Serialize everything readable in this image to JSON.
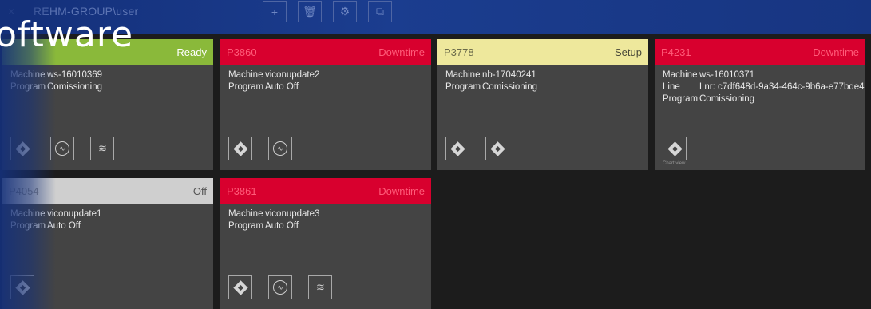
{
  "topbar": {
    "close_glyph": "×",
    "user": "REHM-GROUP\\user",
    "buttons": [
      {
        "icon": "plus-icon",
        "glyph": "+"
      },
      {
        "icon": "trash-icon",
        "glyph": "🗑"
      },
      {
        "icon": "gear-icon",
        "glyph": "⚙"
      },
      {
        "icon": "network-icon",
        "glyph": "⧉"
      }
    ]
  },
  "overlay_title": "oftware",
  "labels": {
    "machine": "Machine",
    "program": "Program",
    "line": "Line"
  },
  "tiles": [
    {
      "id": "",
      "status": "Ready",
      "head_bg": "#8ab93a",
      "id_color": "#e6f2cc",
      "status_color": "#ffffff",
      "machine": "ws-16010369",
      "program": "Comissioning"
    },
    {
      "id": "P3860",
      "status": "Downtime",
      "head_bg": "#d8002e",
      "id_color": "#ff5b79",
      "status_color": "#ff5b79",
      "machine": "viconupdate2",
      "program": "Auto Off"
    },
    {
      "id": "P3778",
      "status": "Setup",
      "head_bg": "#eee89c",
      "id_color": "#6a6a4a",
      "status_color": "#4a4a3a",
      "machine": "nb-17040241",
      "program": "Comissioning"
    },
    {
      "id": "P4231",
      "status": "Downtime",
      "head_bg": "#d8002e",
      "id_color": "#ff5b79",
      "status_color": "#ff5b79",
      "machine": "ws-16010371",
      "line": "Lnr: c7df648d-9a34-464c-9b6a-e77bde4",
      "program": "Comissioning",
      "icon_caption": "Chart view"
    },
    {
      "id": "P4054",
      "status": "Off",
      "head_bg": "#cfcfcf",
      "id_color": "#8a8a8a",
      "status_color": "#555555",
      "machine": "viconupdate1",
      "program": "Auto Off"
    },
    {
      "id": "P3861",
      "status": "Downtime",
      "head_bg": "#d8002e",
      "id_color": "#ff5b79",
      "status_color": "#ff5b79",
      "machine": "viconupdate3",
      "program": "Auto Off"
    }
  ]
}
